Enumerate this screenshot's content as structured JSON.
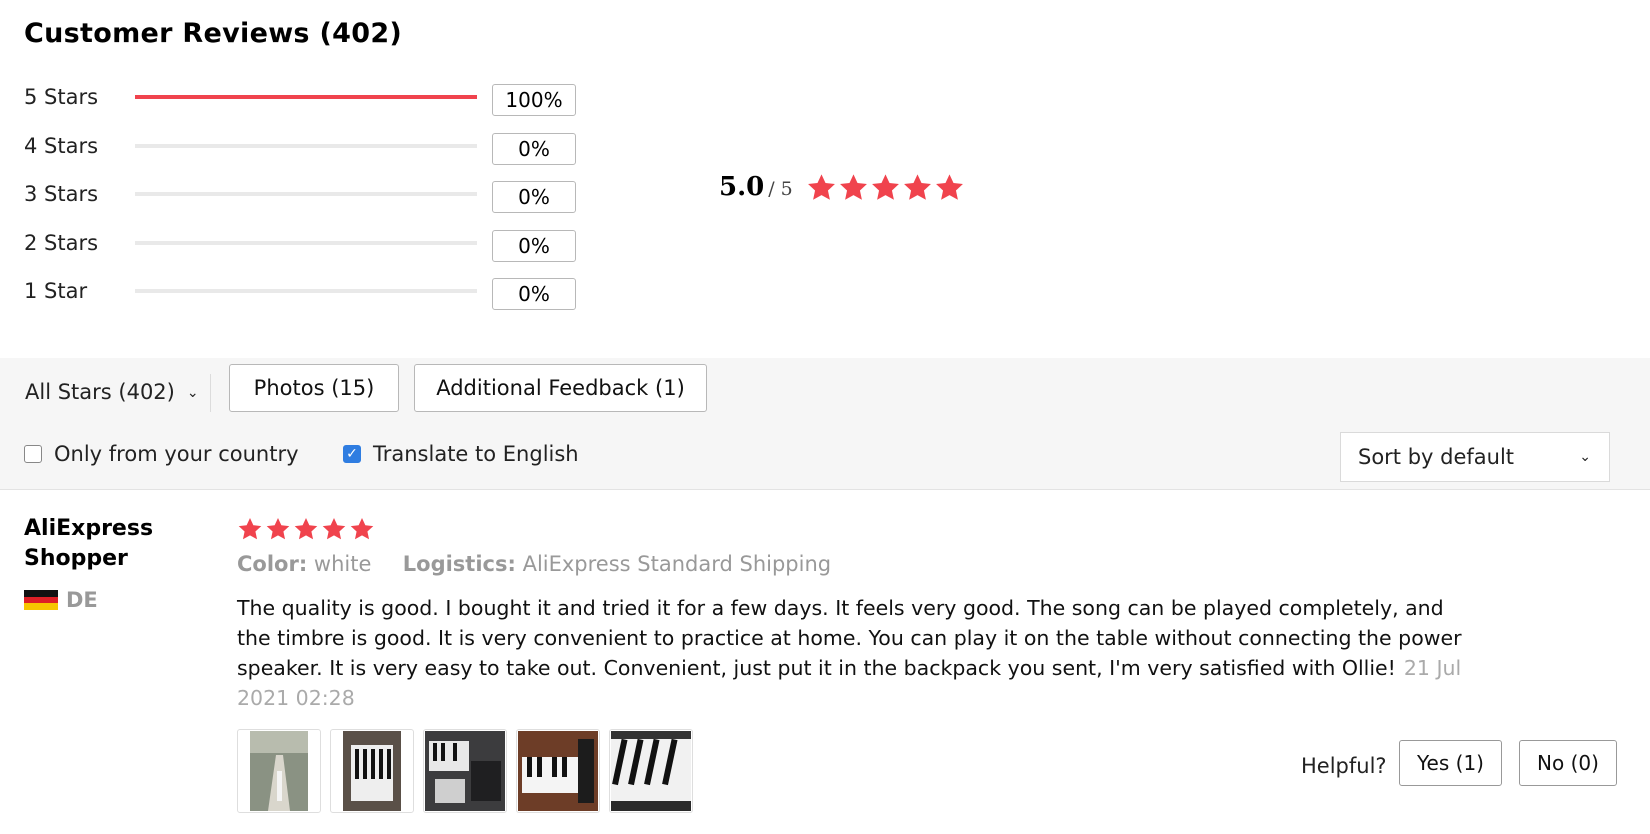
{
  "header": {
    "title": "Customer Reviews (402)"
  },
  "distribution": [
    {
      "label": "5 Stars",
      "percent_text": "100%",
      "fill_fraction": 1.0
    },
    {
      "label": "4 Stars",
      "percent_text": "0%",
      "fill_fraction": 0
    },
    {
      "label": "3 Stars",
      "percent_text": "0%",
      "fill_fraction": 0
    },
    {
      "label": "2 Stars",
      "percent_text": "0%",
      "fill_fraction": 0
    },
    {
      "label": "1 Star",
      "percent_text": "0%",
      "fill_fraction": 0
    }
  ],
  "average": {
    "value": "5.0",
    "max": "/ 5",
    "stars": 5
  },
  "filters": {
    "all_stars": "All Stars (402)",
    "photos": "Photos (15)",
    "additional_feedback": "Additional Feedback (1)",
    "only_country": {
      "label": "Only from your country",
      "checked": false
    },
    "translate": {
      "label": "Translate to English",
      "checked": true
    },
    "sort": "Sort by default"
  },
  "review": {
    "author": "AliExpress Shopper",
    "country_code": "DE",
    "rating": 5,
    "color_label": "Color:",
    "color_value": "white",
    "logistics_label": "Logistics:",
    "logistics_value": "AliExpress Standard Shipping",
    "text": "The quality is good. I bought it and tried it for a few days. It feels very good. The song can be played completely, and the timbre is good. It is very convenient to practice at home. You can play it on the table without connecting the power speaker. It is very easy to take out. Convenient, just put it in the backpack you sent, I'm very satisfied with Ollie!",
    "date": "21 Jul 2021 02:28",
    "photo_count": 5,
    "helpful_label": "Helpful?",
    "yes": "Yes (1)",
    "no": "No (0)"
  },
  "colors": {
    "accent_red": "#f0434d",
    "checkbox_blue": "#2f7de1",
    "muted_text": "#999999"
  }
}
